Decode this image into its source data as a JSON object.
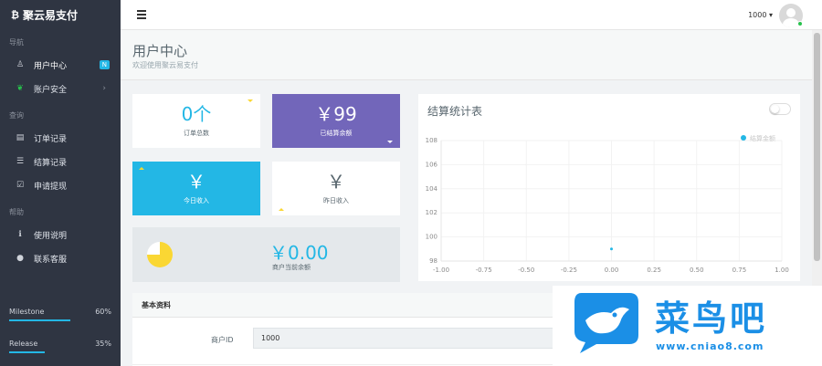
{
  "brand": {
    "logo_icon": "bitcoin-icon",
    "name": "聚云易支付"
  },
  "sidebar": {
    "sections": [
      {
        "title": "导航",
        "items": [
          {
            "label": "用户中心",
            "icon": "user-icon",
            "badge": "N"
          },
          {
            "label": "账户安全",
            "icon": "leaf-icon",
            "chevron": "›"
          }
        ]
      },
      {
        "title": "查询",
        "items": [
          {
            "label": "订单记录",
            "icon": "document-icon"
          },
          {
            "label": "结算记录",
            "icon": "list-icon"
          },
          {
            "label": "申请提现",
            "icon": "checkbox-icon"
          }
        ]
      },
      {
        "title": "帮助",
        "items": [
          {
            "label": "使用说明",
            "icon": "info-icon"
          },
          {
            "label": "联系客服",
            "icon": "qq-icon"
          }
        ]
      }
    ],
    "progress": [
      {
        "label": "Milestone",
        "value": "60%",
        "fraction": 0.6
      },
      {
        "label": "Release",
        "value": "35%",
        "fraction": 0.35
      }
    ]
  },
  "header": {
    "user_id": "1000",
    "caret": "▾"
  },
  "page": {
    "title": "用户中心",
    "subtitle": "欢迎使用聚云易支付"
  },
  "tiles": {
    "orders": {
      "value": "0个",
      "label": "订单总数"
    },
    "settled": {
      "value": "￥99",
      "label": "已结算余额"
    },
    "today": {
      "value": "￥",
      "label": "今日收入"
    },
    "yesterday": {
      "value": "￥",
      "label": "昨日收入"
    },
    "balance": {
      "value": "￥0.00",
      "label": "商户当前余额"
    }
  },
  "chart_data": {
    "type": "line",
    "title": "结算统计表",
    "series": [
      {
        "name": "结算金额",
        "color": "#23b7e5",
        "x": [
          0.0
        ],
        "y": [
          99
        ]
      }
    ],
    "xlim": [
      -1.0,
      1.0
    ],
    "ylim": [
      98,
      108
    ],
    "x_ticks": [
      "-1.00",
      "-0.75",
      "-0.50",
      "-0.25",
      "0.00",
      "0.25",
      "0.50",
      "0.75",
      "1.00"
    ],
    "y_ticks": [
      "108",
      "106",
      "104",
      "102",
      "100",
      "98"
    ],
    "legend": "top-right",
    "grid": true
  },
  "info": {
    "title": "基本资料",
    "fields": [
      {
        "label": "商户ID",
        "value": "1000"
      }
    ]
  },
  "watermark": {
    "text": "菜鸟吧",
    "url": "www.cniao8.com"
  },
  "colors": {
    "sidebar_bg": "#2f3542",
    "accent_blue": "#23b7e5",
    "purple": "#7266ba",
    "yellow": "#fad733"
  }
}
